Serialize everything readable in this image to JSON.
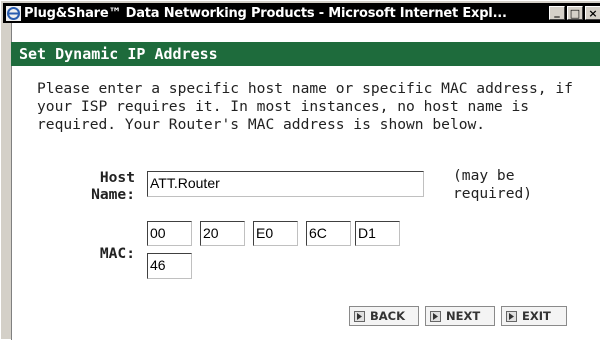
{
  "window": {
    "title": "Plug&Share™ Data Networking Products - Microsoft Internet Expl...",
    "minimize_label": "_",
    "maximize_label": "□",
    "close_label": "×"
  },
  "page": {
    "section_title": "Set Dynamic IP Address",
    "intro_text": "Please enter a specific host name or specific MAC address, if your ISP requires it. In most instances, no host name is required. Your Router's MAC address is shown below.",
    "host_label_line1": "Host",
    "host_label_line2": "Name:",
    "host_name_value": "ATT.Router",
    "host_note_line1": "(may be",
    "host_note_line2": "required)",
    "mac_label": "MAC:",
    "mac_fields": [
      "00",
      "20",
      "E0",
      "6C",
      "D1",
      "46"
    ]
  },
  "buttons": {
    "back": "BACK",
    "next": "NEXT",
    "exit": "EXIT"
  },
  "colors": {
    "header_bg": "#1e6b3c",
    "titlebar_bg": "#000000"
  }
}
